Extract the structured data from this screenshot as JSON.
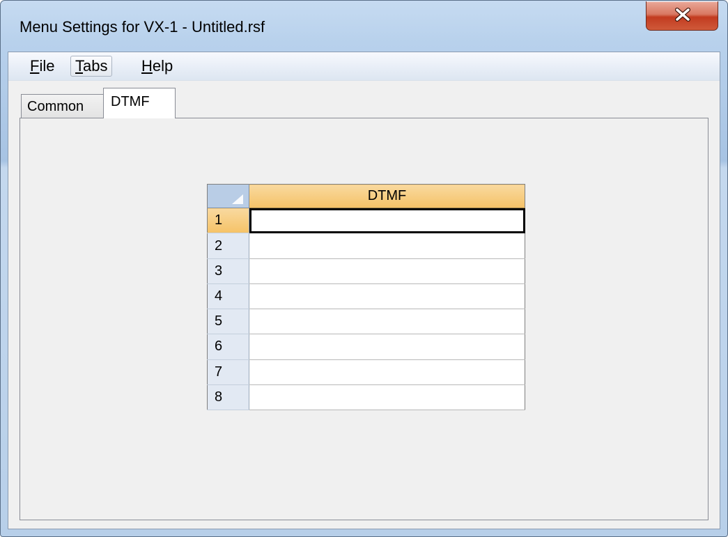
{
  "window": {
    "title": "Menu Settings for VX-1 - Untitled.rsf",
    "close_icon": "close-x-icon"
  },
  "menubar": {
    "items": [
      {
        "label": "File",
        "mnemonic": "F",
        "rest": "ile"
      },
      {
        "label": "Tabs",
        "mnemonic": "T",
        "rest": "abs"
      },
      {
        "label": "Help",
        "mnemonic": "H",
        "rest": "elp"
      }
    ]
  },
  "tabs": [
    {
      "label": "Common",
      "selected": false
    },
    {
      "label": "DTMF",
      "selected": true
    }
  ],
  "grid": {
    "column_header": "DTMF",
    "rows": [
      {
        "num": "1",
        "value": ""
      },
      {
        "num": "2",
        "value": ""
      },
      {
        "num": "3",
        "value": ""
      },
      {
        "num": "4",
        "value": ""
      },
      {
        "num": "5",
        "value": ""
      },
      {
        "num": "6",
        "value": ""
      },
      {
        "num": "7",
        "value": ""
      },
      {
        "num": "8",
        "value": ""
      }
    ],
    "selected_row": "1"
  },
  "colors": {
    "header_orange": "#f5c267",
    "row_header_blue": "#e2e9f3",
    "close_red": "#c23b20"
  }
}
